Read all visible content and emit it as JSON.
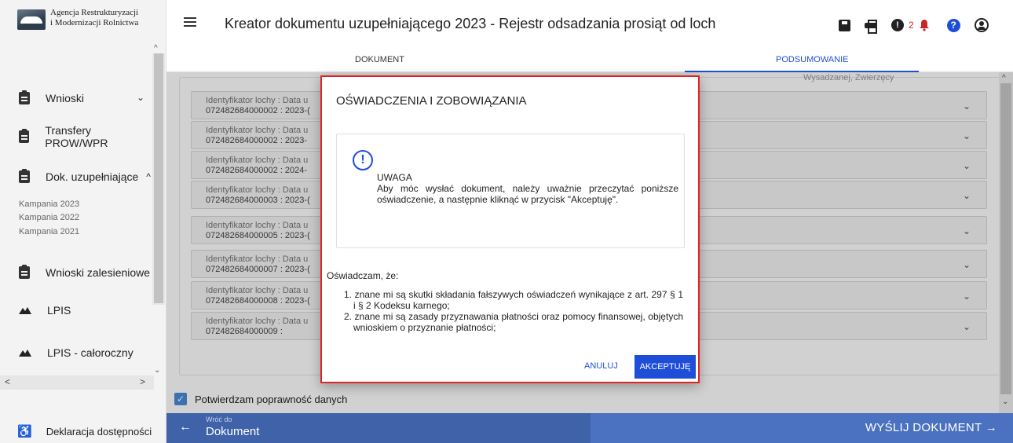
{
  "logo": {
    "line1": "Agencja Restrukturyzacji",
    "line2": "i Modernizacji Rolnictwa"
  },
  "sidebar": {
    "items": [
      {
        "label": "Wnioski",
        "icon": "clipboard-icon",
        "chevron": "⌄"
      },
      {
        "label": "Transfery PROW/WPR",
        "icon": "clipboard-icon",
        "chevron": ""
      },
      {
        "label": "Dok. uzupełniające",
        "icon": "clipboard-icon",
        "chevron": "^"
      },
      {
        "label": "Wnioski zalesieniowe",
        "icon": "clipboard-icon",
        "chevron": ""
      },
      {
        "label": "LPIS",
        "icon": "mountain-icon",
        "chevron": ""
      },
      {
        "label": "LPIS - całoroczny",
        "icon": "mountain-icon",
        "chevron": ""
      }
    ],
    "sub_items": [
      "Kampania 2023",
      "Kampania 2022",
      "Kampania 2021"
    ],
    "accessibility": "Deklaracja dostępności"
  },
  "header": {
    "title": "Kreator dokumentu uzupełniającego 2023 - Rejestr odsadzania prosiąt od loch",
    "alert_count": "2"
  },
  "tabs": {
    "document": "DOKUMENT",
    "summary": "PODSUMOWANIE"
  },
  "panel": {
    "hidden_label": "Wysadzanej, Zwierzęcy",
    "rows": [
      {
        "label": "Identyfikator lochy : Data u",
        "value": "072482684000002 : 2023-("
      },
      {
        "label": "Identyfikator lochy : Data u",
        "value": "072482684000002 : 2023-"
      },
      {
        "label": "Identyfikator lochy : Data u",
        "value": "072482684000002 : 2024-"
      },
      {
        "label": "Identyfikator lochy : Data u",
        "value": "072482684000003 : 2023-("
      },
      {
        "label": "Identyfikator lochy : Data u",
        "value": "072482684000005 : 2023-("
      },
      {
        "label": "Identyfikator lochy : Data u",
        "value": "072482684000007 : 2023-("
      },
      {
        "label": "Identyfikator lochy : Data u",
        "value": "072482684000008 : 2023-("
      },
      {
        "label": "Identyfikator lochy : Data u",
        "value": "072482684000009 :"
      }
    ]
  },
  "confirm": {
    "label": "Potwierdzam poprawność danych",
    "checked": true
  },
  "bottom": {
    "back_small": "Wróć do",
    "back_big": "Dokument",
    "send": "WYŚLIJ DOKUMENT"
  },
  "modal": {
    "title": "OŚWIADCZENIA I ZOBOWIĄZANIA",
    "warning_label": "UWAGA",
    "warning_text": "Aby móc wysłać dokument, należy uważnie przeczytać poniższe oświadczenie, a następnie kliknąć w przycisk \"Akceptuję\".",
    "intro": "Oświadczam, że:",
    "items": [
      "1. znane mi są skutki składania fałszywych oświadczeń wynikające z art. 297 § 1 i § 2 Kodeksu karnego;",
      "2. znane mi są zasady przyznawania płatności oraz pomocy finansowej, objętych wnioskiem o przyznanie płatności;"
    ],
    "cancel": "ANULUJ",
    "accept": "AKCEPTUJĘ"
  },
  "colors": {
    "accent": "#1e4ed8",
    "bottom_bar": "#3f62a8",
    "modal_border": "#e02424"
  }
}
